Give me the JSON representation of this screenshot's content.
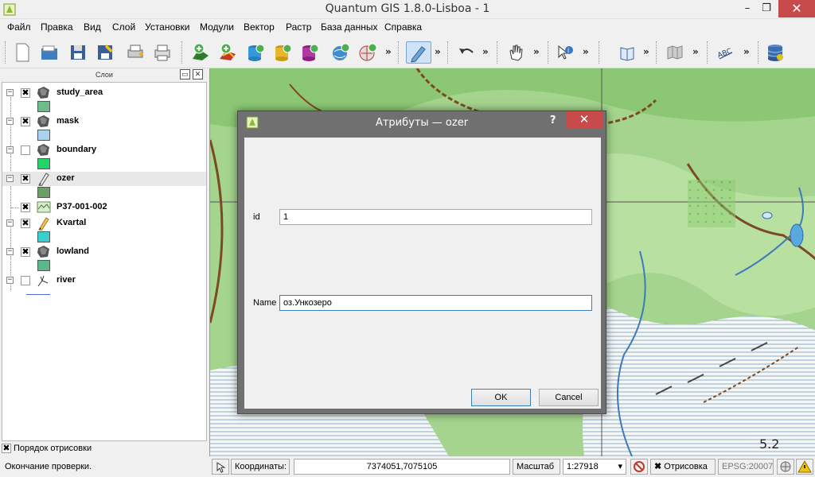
{
  "window": {
    "title": "Quantum GIS 1.8.0-Lisboa - 1",
    "controls": {
      "minimize": "–",
      "maximize": "❐",
      "close": "✕"
    }
  },
  "menu": [
    "Файл",
    "Правка",
    "Вид",
    "Слой",
    "Установки",
    "Модули",
    "Вектор",
    "Растр",
    "База данных",
    "Справка"
  ],
  "toolbar": {
    "more": "»",
    "tools": [
      "new-project",
      "open-project",
      "save-project",
      "save-as",
      "print-composer",
      "print",
      "add-vector-layer",
      "add-raster-layer",
      "add-postgis-layer",
      "add-spatialite-layer",
      "add-mssql-layer",
      "add-wms-layer",
      "add-wfs-layer",
      "toggle-editing",
      "undo",
      "pan",
      "identify",
      "help",
      "map-tips",
      "label",
      "db-manager"
    ]
  },
  "layers_panel": {
    "title": "Слои",
    "float_btn": "▭",
    "close_btn": "✕",
    "layers": [
      {
        "name": "study_area",
        "checked": true,
        "icon": "polygon-icon",
        "swatch": "#6cbd8a",
        "expanded": true
      },
      {
        "name": "mask",
        "checked": true,
        "icon": "polygon-icon",
        "swatch": "#a8d4f0",
        "expanded": true
      },
      {
        "name": "boundary",
        "checked": false,
        "icon": "polygon-icon",
        "swatch": "#22d46a",
        "expanded": true
      },
      {
        "name": "ozer",
        "checked": true,
        "icon": "pencil-icon",
        "swatch": "#6a9f6a",
        "expanded": true,
        "selected": true
      },
      {
        "name": "P37-001-002",
        "checked": true,
        "icon": "raster-icon",
        "expanded": false
      },
      {
        "name": "Kvartal",
        "checked": true,
        "icon": "pencil-icon",
        "swatch": "#3ad0d0",
        "expanded": true
      },
      {
        "name": "lowland",
        "checked": true,
        "icon": "polygon-icon",
        "swatch": "#5ab889",
        "expanded": true
      },
      {
        "name": "river",
        "checked": false,
        "icon": "line-icon",
        "expanded": true
      }
    ],
    "order_label": "Порядок отрисовки",
    "order_checked": true
  },
  "status": {
    "message": "Окончание проверки.",
    "coords_label": "Координаты:",
    "coords_value": "7374051,7075105",
    "scale_label": "Масштаб",
    "scale_value": "1:27918",
    "render_label": "Отрисовка",
    "render_checked": true,
    "epsg": "EPSG:20007"
  },
  "dialog": {
    "title": "Атрибуты — ozer",
    "help": "?",
    "close": "✕",
    "fields": [
      {
        "label": "id",
        "value": "1"
      },
      {
        "label": "Name",
        "value": "оз.Ункозеро"
      }
    ],
    "ok": "OK",
    "cancel": "Cancel"
  }
}
